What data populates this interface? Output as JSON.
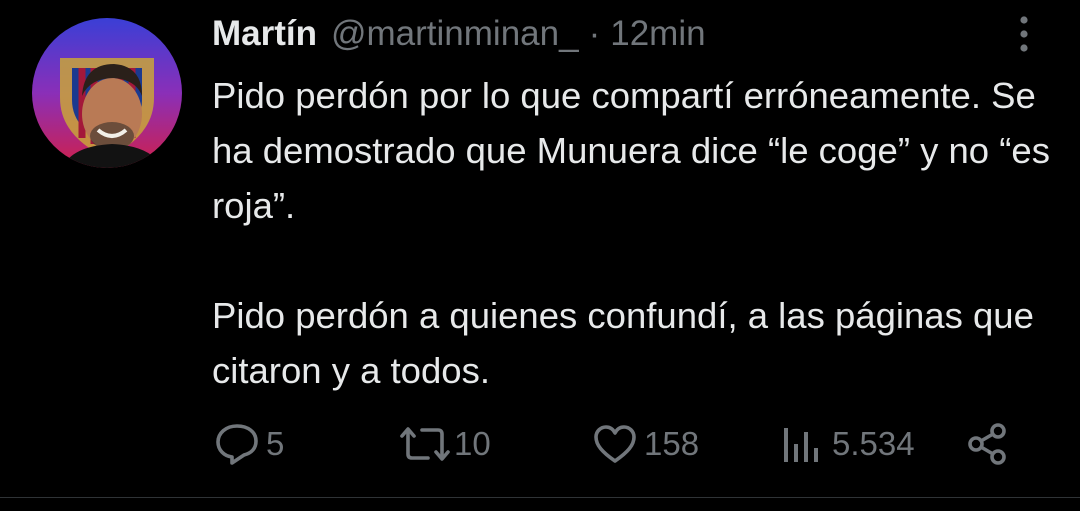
{
  "tweet": {
    "author_name": "Martín",
    "author_handle": "@martinminan_",
    "separator": "·",
    "time": "12min",
    "paragraph_1": "Pido perdón por lo que compartí erróneamente. Se ha demostrado que Munuera dice “le coge” y no “es roja”.",
    "paragraph_2": "Pido perdón a quienes confundí, a las páginas que citaron y a todos."
  },
  "actions": {
    "replies": "5",
    "retweets": "10",
    "likes": "158",
    "views": "5.534"
  },
  "icons": {
    "reply": "reply-icon",
    "retweet": "retweet-icon",
    "like": "heart-icon",
    "views": "views-icon",
    "share": "share-icon",
    "more": "more-icon"
  },
  "colors": {
    "background": "#000000",
    "text": "#e7e9ea",
    "muted": "#71767b"
  }
}
